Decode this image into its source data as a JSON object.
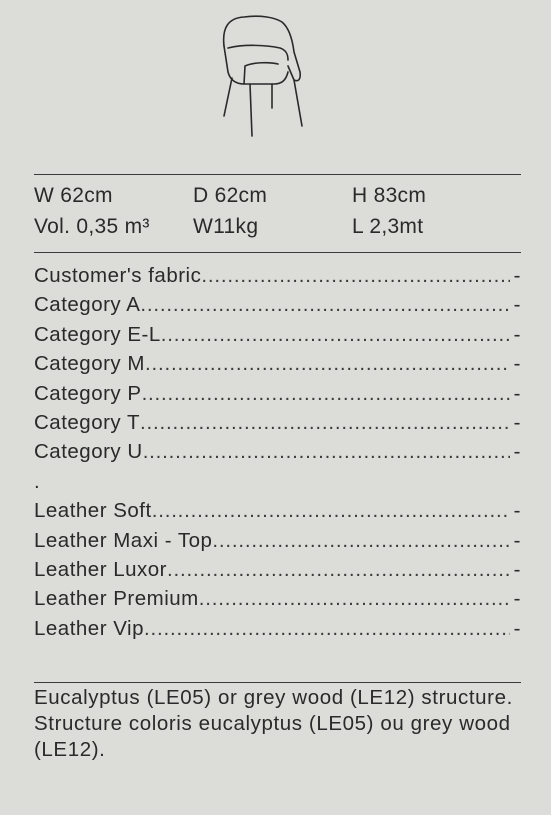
{
  "dimensions": {
    "row1": [
      "W 62cm",
      "D 62cm",
      "H 83cm"
    ],
    "row2": [
      "Vol. 0,35 m³",
      "W11kg",
      "L 2,3mt"
    ]
  },
  "prices": [
    {
      "label": "Customer's fabric",
      "value": "-"
    },
    {
      "label": "Category A",
      "value": "-"
    },
    {
      "label": "Category E-L",
      "value": "-"
    },
    {
      "label": "Category M",
      "value": "-"
    },
    {
      "label": "Category P",
      "value": "-"
    },
    {
      "label": "Category T",
      "value": "-"
    },
    {
      "label": "Category U",
      "value": "-"
    },
    {
      "label": ".",
      "value": ""
    },
    {
      "label": "Leather Soft",
      "value": "-"
    },
    {
      "label": "Leather Maxi - Top",
      "value": "-"
    },
    {
      "label": "Leather Luxor",
      "value": "-"
    },
    {
      "label": "Leather Premium",
      "value": "-"
    },
    {
      "label": "Leather Vip",
      "value": "-"
    }
  ],
  "notes": {
    "english": "Eucalyptus (LE05) or grey wood (LE12) structure.",
    "french": "Structure coloris eucalyptus (LE05) ou grey wood (LE12)."
  }
}
